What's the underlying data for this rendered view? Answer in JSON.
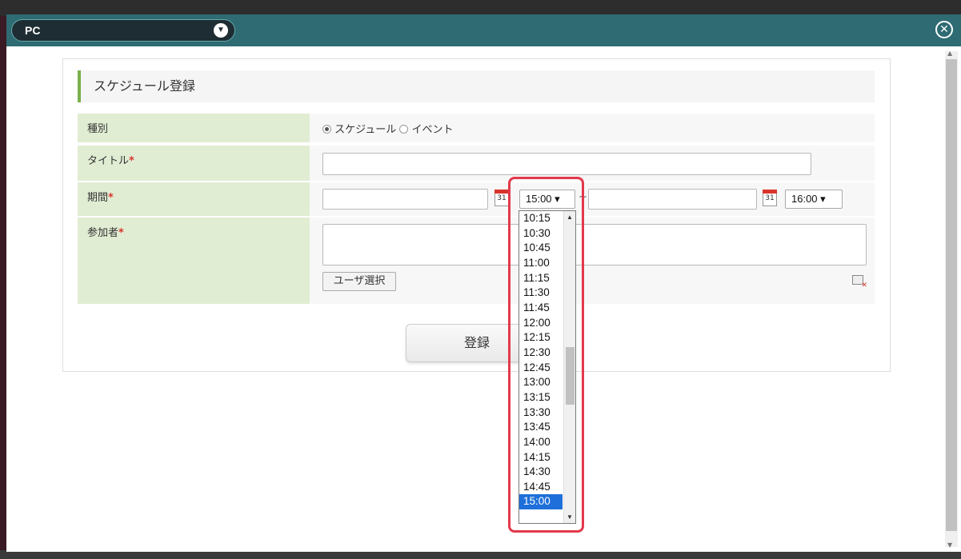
{
  "modal": {
    "device_select": "PC",
    "close_icon": "close-circle-icon"
  },
  "form": {
    "title": "スケジュール登録",
    "rows": {
      "type_label": "種別",
      "title_label": "タイトル",
      "period_label": "期間",
      "members_label": "参加者",
      "required_mark": "*"
    },
    "type_options": [
      "スケジュール",
      "イベント"
    ],
    "type_selected": "スケジュール",
    "title_value": "",
    "date_from": "",
    "date_to": "",
    "time_from": "15:00",
    "time_to": "16:00",
    "calendar_icon_text": "31",
    "user_select_button": "ユーザ選択",
    "submit_button": "登録"
  },
  "time_dropdown": {
    "options": [
      "10:15",
      "10:30",
      "10:45",
      "11:00",
      "11:15",
      "11:30",
      "11:45",
      "12:00",
      "12:15",
      "12:30",
      "12:45",
      "13:00",
      "13:15",
      "13:30",
      "13:45",
      "14:00",
      "14:15",
      "14:30",
      "14:45",
      "15:00"
    ],
    "selected": "15:00"
  },
  "colors": {
    "header": "#2e6b73",
    "label_bg": "#e1edd3",
    "accent": "#7ab04c",
    "highlight": "#e3394b",
    "selected_option": "#1e6fd9"
  }
}
